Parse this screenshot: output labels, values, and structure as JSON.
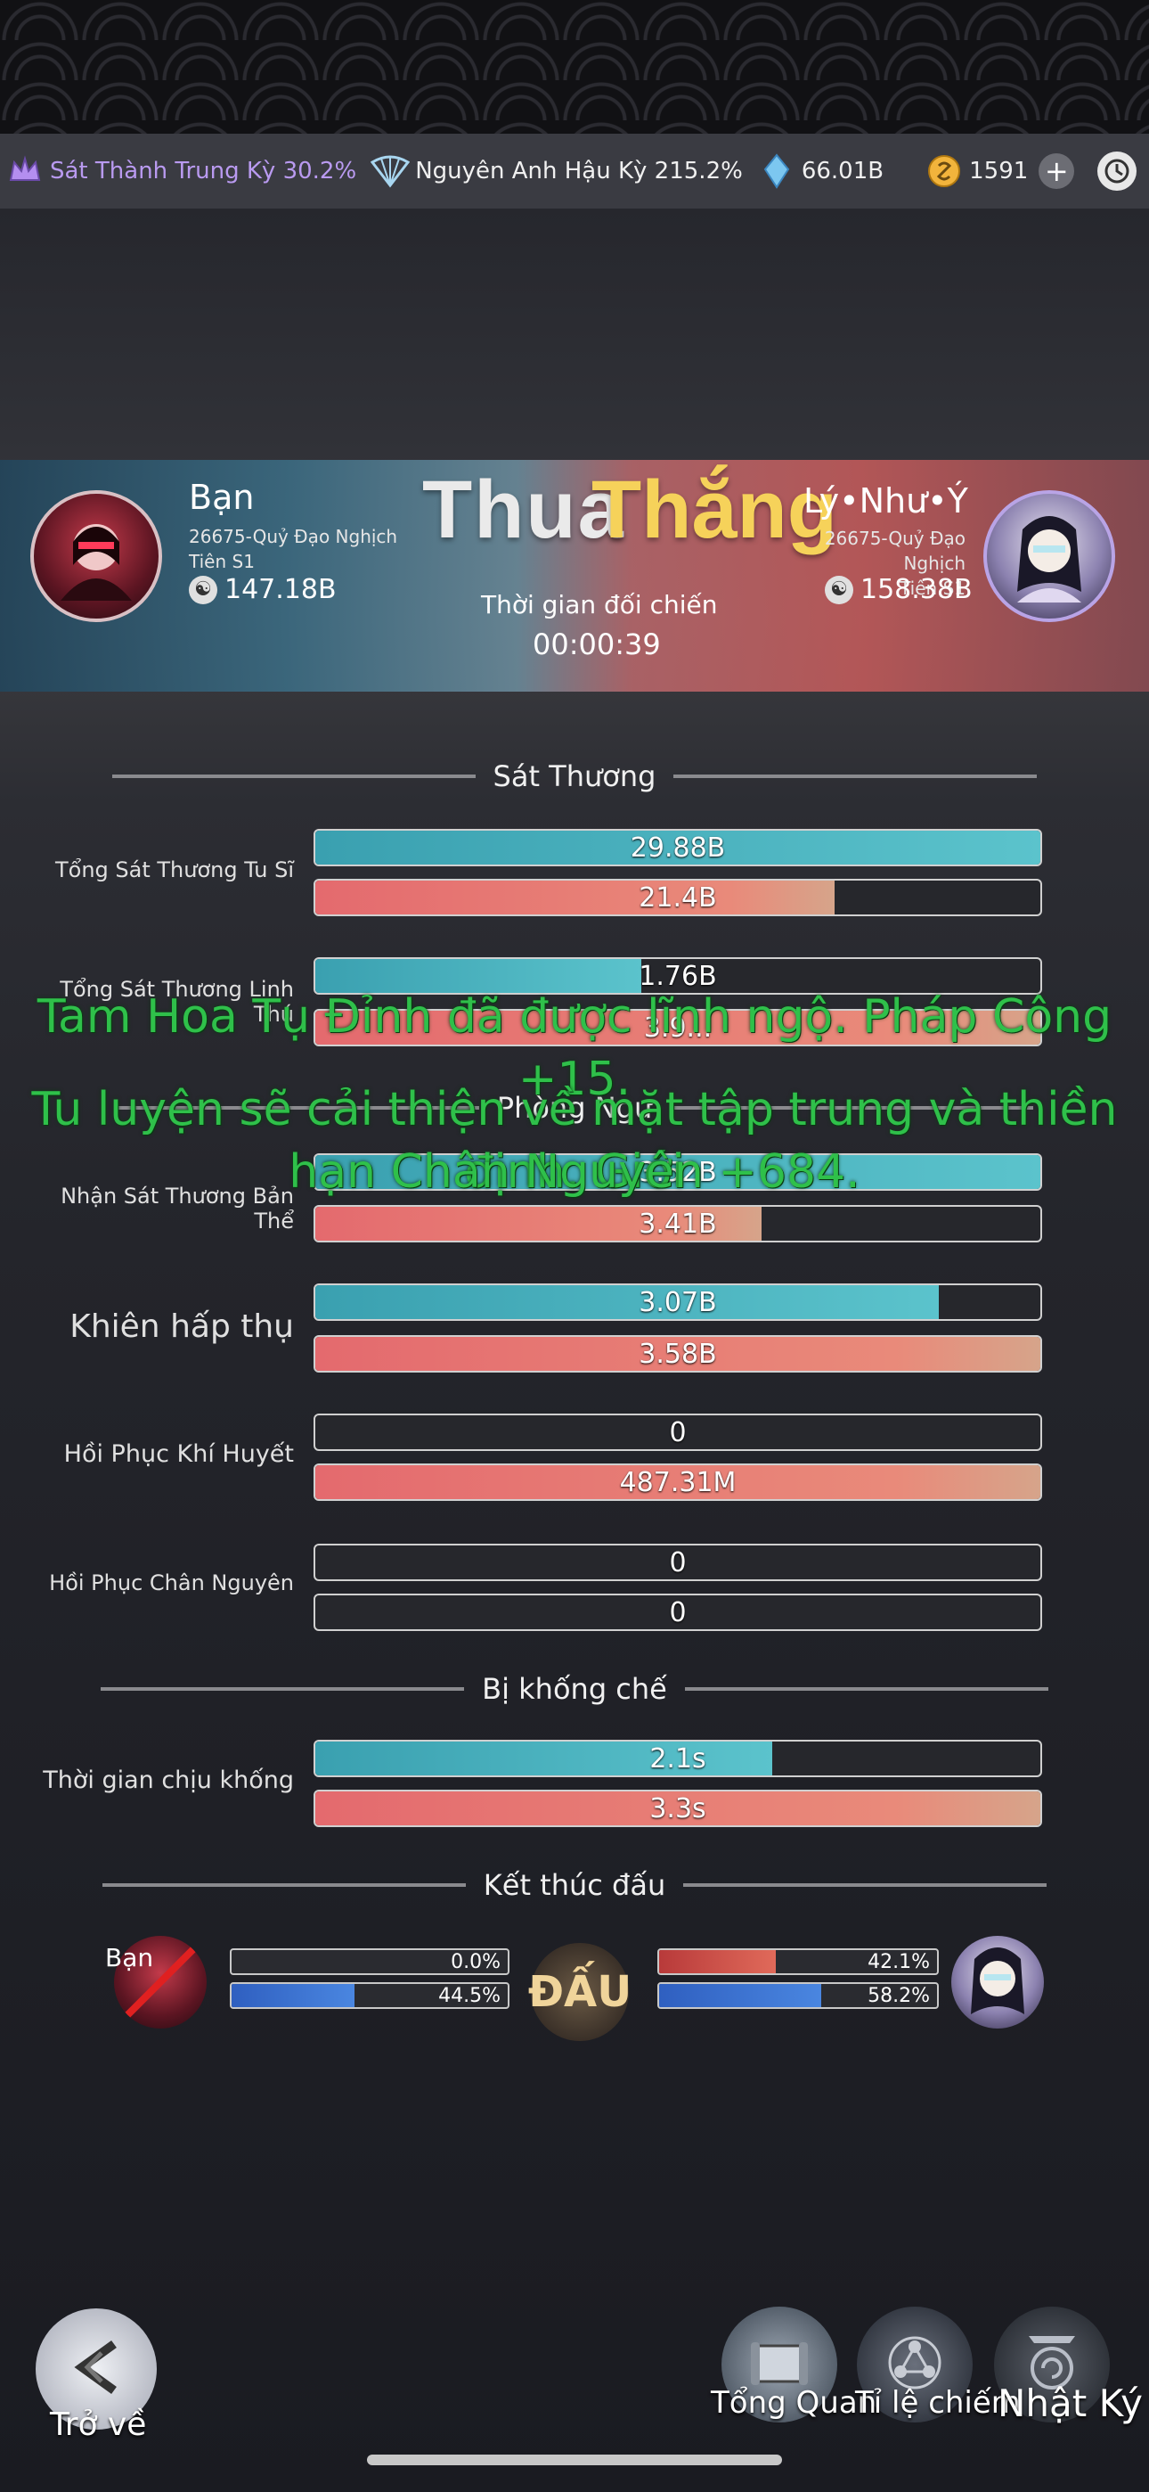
{
  "topbar": {
    "realm1": "Sát Thành Trung Kỳ 30.2%",
    "realm2": "Nguyên Anh Hậu Kỳ 215.2%",
    "crystals": "66.01B",
    "coins": "1591",
    "plus_icon": "+"
  },
  "battle": {
    "left": {
      "name": "Bạn",
      "server_line1": "26675-Quỷ Đạo Nghịch",
      "server_line2": "Tiên S1",
      "power": "147.18B"
    },
    "right": {
      "name": "Lý•Như•Ý",
      "server_line1": "26675-Quỷ Đạo Nghịch",
      "server_line2": "Tiên S1",
      "power": "158.38B"
    },
    "result_lose": "Thua",
    "result_win": "Thắng",
    "time_label": "Thời gian đối chiến",
    "time_value": "00:00:39"
  },
  "sections": {
    "damage": "Sát Thương",
    "control": "Bị khống chế",
    "end": "Kết thúc đấu"
  },
  "rows": [
    {
      "label": "Tổng Sát Thương Tu Sĩ",
      "blue": "29.88B",
      "red": "21.4B",
      "blue_frac": 1.0,
      "red_frac": 0.716
    },
    {
      "label": "Tổng Sát Thương Linh Thú",
      "blue": "1.76B",
      "red": "3.9...",
      "blue_frac": 0.45,
      "red_frac": 1.0
    },
    {
      "label": "Nhận Sát Thương Bản Thể",
      "blue": "3.52B",
      "red": "3.41B",
      "blue_frac": 1.0,
      "red_frac": 0.615
    },
    {
      "label": "Khiên hấp thụ",
      "blue": "3.07B",
      "red": "3.58B",
      "blue_frac": 0.86,
      "red_frac": 1.0
    },
    {
      "label": "Hồi Phục Khí Huyết",
      "blue": "0",
      "red": "487.31M",
      "blue_frac": 0,
      "red_frac": 1.0
    },
    {
      "label": "Hồi Phục Chân Nguyên",
      "blue": "0",
      "red": "0",
      "blue_frac": 0,
      "red_frac": 0
    },
    {
      "label": "Thời gian chịu khống",
      "blue": "2.1s",
      "red": "3.3s",
      "blue_frac": 0.63,
      "red_frac": 1.0
    }
  ],
  "hidden_label": "Phòng Ngự",
  "overlay": {
    "line1": "Tam Hoa Tụ Đỉnh đã được lĩnh ngộ. Pháp Công +15.",
    "line2": "Tu luyện sẽ cải thiện về mặt tập trung và thiền định. Giới",
    "line3": "hạn Chân Nguyên +684."
  },
  "end": {
    "left_label": "Bạn",
    "left_hp": "0.0%",
    "left_mp": "44.5%",
    "right_hp": "42.1%",
    "right_mp": "58.2%",
    "left_hp_frac": 0.0,
    "left_mp_frac": 0.445,
    "right_hp_frac": 0.421,
    "right_mp_frac": 0.582,
    "vs": "ĐẤU"
  },
  "bottom": {
    "back": "Trở về",
    "overview": "Tổng Quan",
    "ratio": "Tỉ lệ chiếm",
    "log": "Nhật Ký"
  },
  "colors": {
    "blue": "#4bb3bf",
    "red": "#e46a6e",
    "overlay_green": "#2fc04a",
    "win_gold": "#f6d25a"
  }
}
